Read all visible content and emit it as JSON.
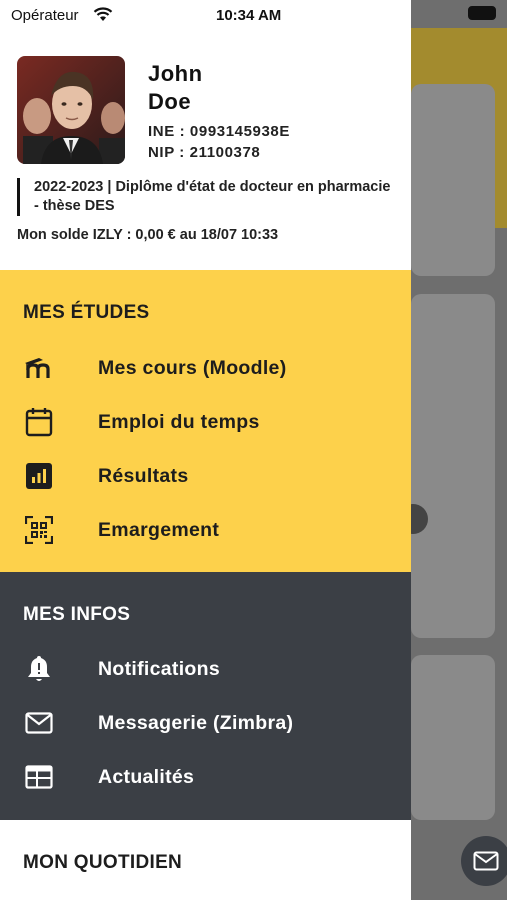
{
  "status_bar": {
    "carrier": "Opérateur",
    "time": "10:34 AM"
  },
  "profile": {
    "first_name": "John",
    "last_name": "Doe",
    "ine": "INE : 0993145938E",
    "nip": "NIP : 21100378",
    "degree": "2022-2023 | Diplôme d'état de docteur en pharmacie - thèse DES",
    "balance": "Mon solde IZLY : 0,00 € au 18/07 10:33"
  },
  "sections": {
    "etudes": {
      "title": "MES ÉTUDES",
      "items": [
        {
          "label": "Mes cours (Moodle)",
          "icon": "moodle-icon"
        },
        {
          "label": "Emploi du temps",
          "icon": "calendar-icon"
        },
        {
          "label": "Résultats",
          "icon": "chart-icon"
        },
        {
          "label": "Emargement",
          "icon": "qr-code-icon"
        }
      ]
    },
    "infos": {
      "title": "MES INFOS",
      "items": [
        {
          "label": "Notifications",
          "icon": "bell-icon"
        },
        {
          "label": "Messagerie (Zimbra)",
          "icon": "mail-icon"
        },
        {
          "label": "Actualités",
          "icon": "news-icon"
        }
      ]
    },
    "quotidien": {
      "title": "MON QUOTIDIEN"
    }
  },
  "colors": {
    "etudes_bg": "#fdd14b",
    "infos_bg": "#3b3f45",
    "accent_text_dark": "#1d1d1d"
  }
}
